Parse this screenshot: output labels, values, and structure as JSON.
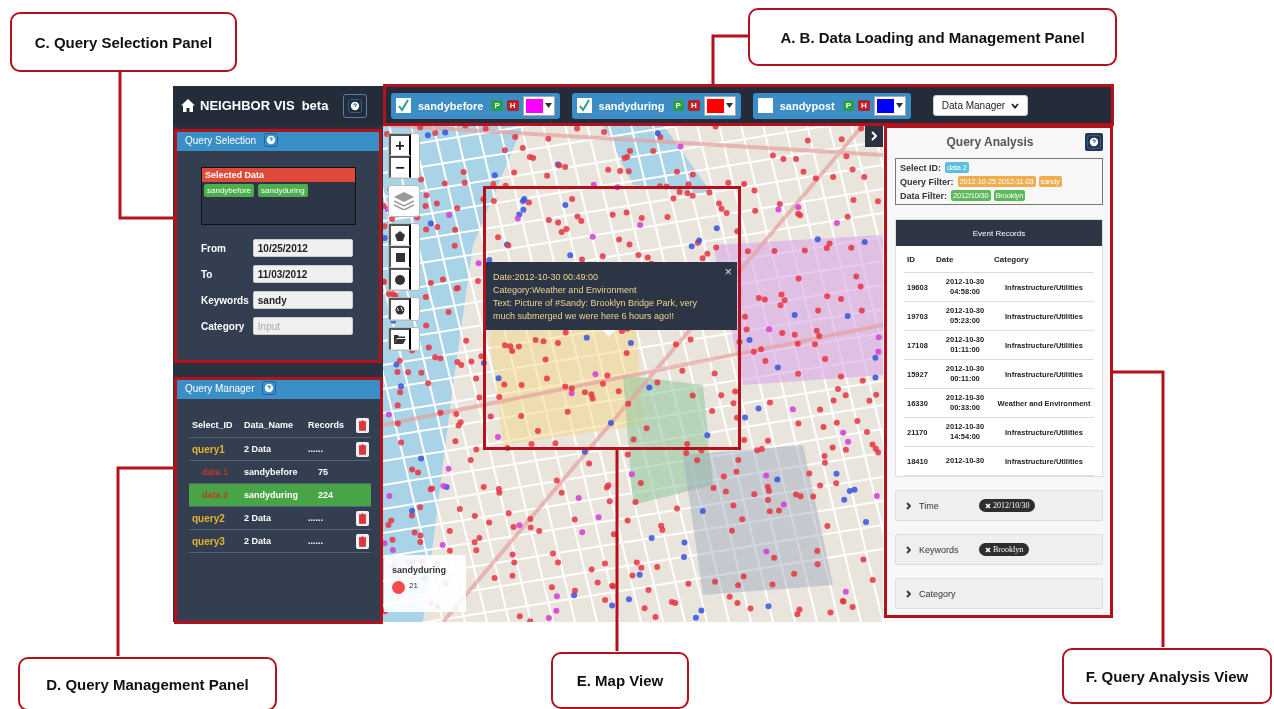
{
  "callouts": [
    {
      "label": "C. Query Selection Panel"
    },
    {
      "label": "A. B. Data Loading and Management Panel"
    },
    {
      "label": "D. Query Management Panel"
    },
    {
      "label": "E. Map View"
    },
    {
      "label": "F. Query Analysis View"
    }
  ],
  "app": {
    "brand": "NEIGHBOR VIS",
    "tag": "beta",
    "datasets": [
      {
        "name": "sandybefore",
        "checked": true,
        "p": "P",
        "h": "H",
        "color": "#ff00ff"
      },
      {
        "name": "sandyduring",
        "checked": true,
        "p": "P",
        "h": "H",
        "color": "#ff0000"
      },
      {
        "name": "sandypost",
        "checked": false,
        "p": "P",
        "h": "H",
        "color": "#0000ff"
      }
    ],
    "data_manager": "Data Manager",
    "query_selection": {
      "title": "Query Selection",
      "selected_title": "Selected Data",
      "selected": [
        "sandybefore",
        "sandyduring"
      ],
      "fields": [
        {
          "label": "From",
          "value": "10/25/2012"
        },
        {
          "label": "To",
          "value": "11/03/2012"
        },
        {
          "label": "Keywords",
          "value": "sandy"
        },
        {
          "label": "Category",
          "placeholder": "Input"
        }
      ]
    },
    "query_manager": {
      "title": "Query Manager",
      "columns": [
        "Select_ID",
        "Data_Name",
        "Records"
      ],
      "rows": [
        {
          "kind": "query",
          "id": "query1",
          "name": "2 Data",
          "records": "......",
          "selected": false
        },
        {
          "kind": "data",
          "id": "data 1",
          "name": "sandybefore",
          "records": "75",
          "selected": false
        },
        {
          "kind": "data",
          "id": "data 2",
          "name": "sandyduring",
          "records": "224",
          "selected": true
        },
        {
          "kind": "query",
          "id": "query2",
          "name": "2 Data",
          "records": "......",
          "selected": false
        },
        {
          "kind": "query",
          "id": "query3",
          "name": "2 Data",
          "records": "......",
          "selected": false
        }
      ]
    },
    "map": {
      "zoom_in": "+",
      "zoom_out": "−",
      "popup": {
        "close": "×",
        "lines": [
          "Date:2012-10-30 00:49:00",
          "Category:Weather and Environment",
          "Text: Picture of #Sandy: Brooklyn Bridge Park, very much submerged we were here 6 hours ago!!"
        ]
      },
      "legend": {
        "title": "sandyduring",
        "count": "21",
        "color": "#f04a4a"
      }
    },
    "analysis": {
      "title": "Query Analysis",
      "filters": [
        {
          "label": "Select ID:",
          "tags": [
            {
              "text": "data 2",
              "color": "#5bc0de"
            }
          ]
        },
        {
          "label": "Query Filter:",
          "tags": [
            {
              "text": "2012-10-25 2012-11-03",
              "color": "#f0ad4e"
            },
            {
              "text": "sandy",
              "color": "#f0ad4e"
            }
          ]
        },
        {
          "label": "Data Filter:",
          "tags": [
            {
              "text": "2012/10/30",
              "color": "#5cb85c"
            },
            {
              "text": "Brooklyn",
              "color": "#5cb85c"
            }
          ]
        }
      ],
      "records_title": "Event Records",
      "columns": [
        "ID",
        "Date",
        "Category"
      ],
      "records": [
        {
          "id": "19603",
          "date": "2012-10-30",
          "time": "04:58:00",
          "category": "Infrastructure/Utilities"
        },
        {
          "id": "19703",
          "date": "2012-10-30",
          "time": "05:23:00",
          "category": "Infrastructure/Utilities"
        },
        {
          "id": "17108",
          "date": "2012-10-30",
          "time": "01:11:00",
          "category": "Infrastructure/Utilities"
        },
        {
          "id": "15927",
          "date": "2012-10-30",
          "time": "00:11:00",
          "category": "Infrastructure/Utilities"
        },
        {
          "id": "16330",
          "date": "2012-10-30",
          "time": "00:33:00",
          "category": "Weather and Environment"
        },
        {
          "id": "21170",
          "date": "2012-10-30",
          "time": "14:54:00",
          "category": "Infrastructure/Utilities"
        },
        {
          "id": "18410",
          "date": "2012-10-30",
          "category": "Infrastructure/Utilities"
        }
      ],
      "sections": [
        {
          "label": "Time",
          "tag": "2012/10/30"
        },
        {
          "label": "Keywords",
          "tag": "Brooklyn"
        },
        {
          "label": "Category"
        }
      ]
    }
  }
}
